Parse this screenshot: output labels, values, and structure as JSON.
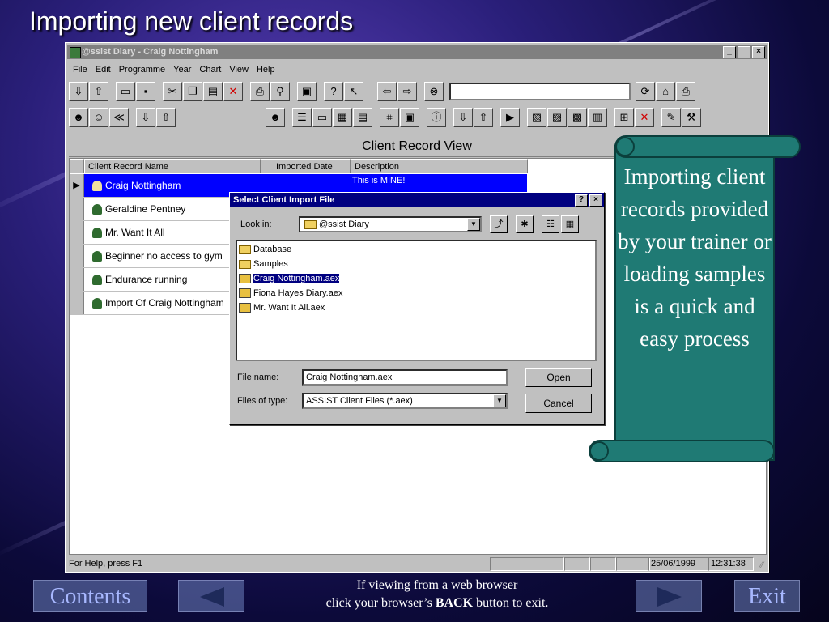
{
  "slide": {
    "title": "Importing new client records",
    "callout_text": "Importing client records provided by your trainer or loading samples is a quick and easy process",
    "footer_line1": "If viewing from a web browser",
    "footer_line2_pre": "click your browser’s",
    "footer_line2_bold": "BACK",
    "footer_line2_post": "button to exit.",
    "contents_label": "Contents",
    "exit_label": "Exit"
  },
  "app": {
    "window_title": "@ssist Diary - Craig Nottingham",
    "menu": [
      "File",
      "Edit",
      "Programme",
      "Year",
      "Chart",
      "View",
      "Help"
    ],
    "view_title": "Client Record View",
    "columns": [
      "Client Record Name",
      "Imported Date",
      "Description"
    ],
    "rows": [
      {
        "name": "Craig Nottingham",
        "imported": "",
        "description": "This is MINE!",
        "selected": true
      },
      {
        "name": "Geraldine Pentney",
        "imported": "",
        "description": "",
        "selected": false
      },
      {
        "name": "Mr. Want It All",
        "imported": "",
        "description": "",
        "selected": false
      },
      {
        "name": "Beginner no access to gym",
        "imported": "",
        "description": "",
        "selected": false
      },
      {
        "name": "Endurance running",
        "imported": "",
        "description": "",
        "selected": false
      },
      {
        "name": "Import Of Craig Nottingham",
        "imported": "",
        "description": "",
        "selected": false
      }
    ],
    "status_help": "For Help, press F1",
    "status_date": "25/06/1999",
    "status_time": "12:31:38"
  },
  "dialog": {
    "title": "Select Client Import File",
    "look_in_label": "Look in:",
    "look_in_value": "@ssist Diary",
    "files": [
      {
        "name": "Database",
        "type": "folder",
        "selected": false
      },
      {
        "name": "Samples",
        "type": "folder",
        "selected": false
      },
      {
        "name": "Craig Nottingham.aex",
        "type": "aex",
        "selected": true
      },
      {
        "name": "Fiona Hayes Diary.aex",
        "type": "aex",
        "selected": false
      },
      {
        "name": "Mr. Want It All.aex",
        "type": "aex",
        "selected": false
      }
    ],
    "file_name_label": "File name:",
    "file_name_value": "Craig Nottingham.aex",
    "file_type_label": "Files of type:",
    "file_type_value": "ASSIST Client Files (*.aex)",
    "open_label": "Open",
    "cancel_label": "Cancel"
  },
  "colors": {
    "selection": "#0000ff",
    "dialog_title": "#000080",
    "callout": "#1f7a74"
  }
}
